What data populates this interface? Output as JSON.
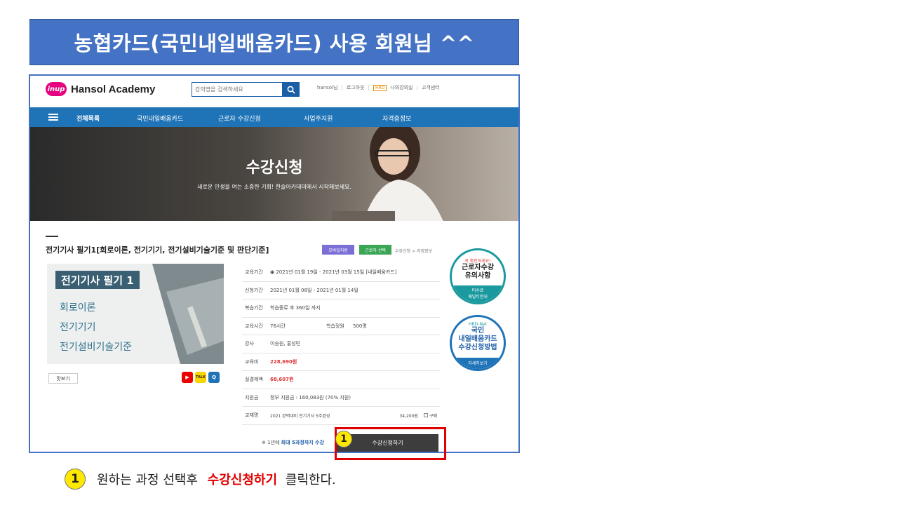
{
  "banner": {
    "title": "농협카드(국민내일배움카드) 사용 회원님 ^^"
  },
  "site": {
    "logo_badge": "inup",
    "logo_text": "Hansol Academy",
    "search_placeholder": "강의명을 검색하세요",
    "top_links": [
      "hansol님",
      "로그아웃",
      "HRD",
      "나의강의실",
      "고객센터"
    ]
  },
  "nav": {
    "all_menu": "전체목록",
    "items": [
      "국민내일배움카드",
      "근로자 수강신청",
      "사업주지원",
      "자격증정보"
    ]
  },
  "hero": {
    "title": "수강신청",
    "subtitle": "새로운 인생을 여는 소중한 기회! 한솔아카데미에서 시작해보세요."
  },
  "course": {
    "title": "전기기사 필기1[회로이론, 전기기기, 전기설비기술기준 및 판단기준]",
    "badge_mobile": "모바일지원",
    "badge_worker": "근로자 선택",
    "breadcrumb": "수강신청 > 과정정보",
    "thumb_title": "전기기사 필기 1",
    "thumb_lines": [
      "회로이론",
      "전기기기",
      "전기설비기술기준"
    ],
    "preview_label": "맛보기",
    "icons": {
      "youtube": "▶",
      "talk": "TALK",
      "qa": "Q"
    }
  },
  "info": {
    "rows": [
      {
        "label": "교육기간",
        "value": "◉ 2021년 01월 19일 - 2021년 03월 15일 [내일배움카드]"
      },
      {
        "label": "신청기간",
        "value": "2021년 01월 08일 - 2021년 01월 14일"
      },
      {
        "label": "복습기간",
        "value": "학습종료 후 360일 까지"
      },
      {
        "label": "교육시간",
        "value": "76시간",
        "label2": "학습정원",
        "value2": "500명"
      },
      {
        "label": "강사",
        "value": "이승원, 홍성민"
      },
      {
        "label": "교육비",
        "value": "228,690원"
      },
      {
        "label": "실결제액",
        "value": "68,607원"
      },
      {
        "label": "지원금",
        "value": "정부 지원금 : 160,083원 (70% 지원)"
      },
      {
        "label": "교재명",
        "value": "2021 완벽대비 전기기사 5주완성",
        "value2": "34,200원",
        "value3": "구매"
      }
    ],
    "notice_prefix": "※ 1년에 ",
    "notice_bold": "최대 5과정까지 수강",
    "apply_button": "수강신청하기"
  },
  "side": {
    "c1_small": "꼭 확인하세요!",
    "c1_big1": "근로자수강",
    "c1_big2": "유의사항",
    "c1_foot1": "미수료",
    "c1_foot2": "패널티안내",
    "c2_logo": "HRD-Net",
    "c2_big1": "국민",
    "c2_big2": "내일배움카드",
    "c2_big3": "수강신청방법",
    "c2_foot": "자세히보기"
  },
  "step": {
    "number": "1",
    "text_before": "원하는 과정 선택후",
    "text_highlight": "수강신청하기",
    "text_after": "클릭한다."
  }
}
